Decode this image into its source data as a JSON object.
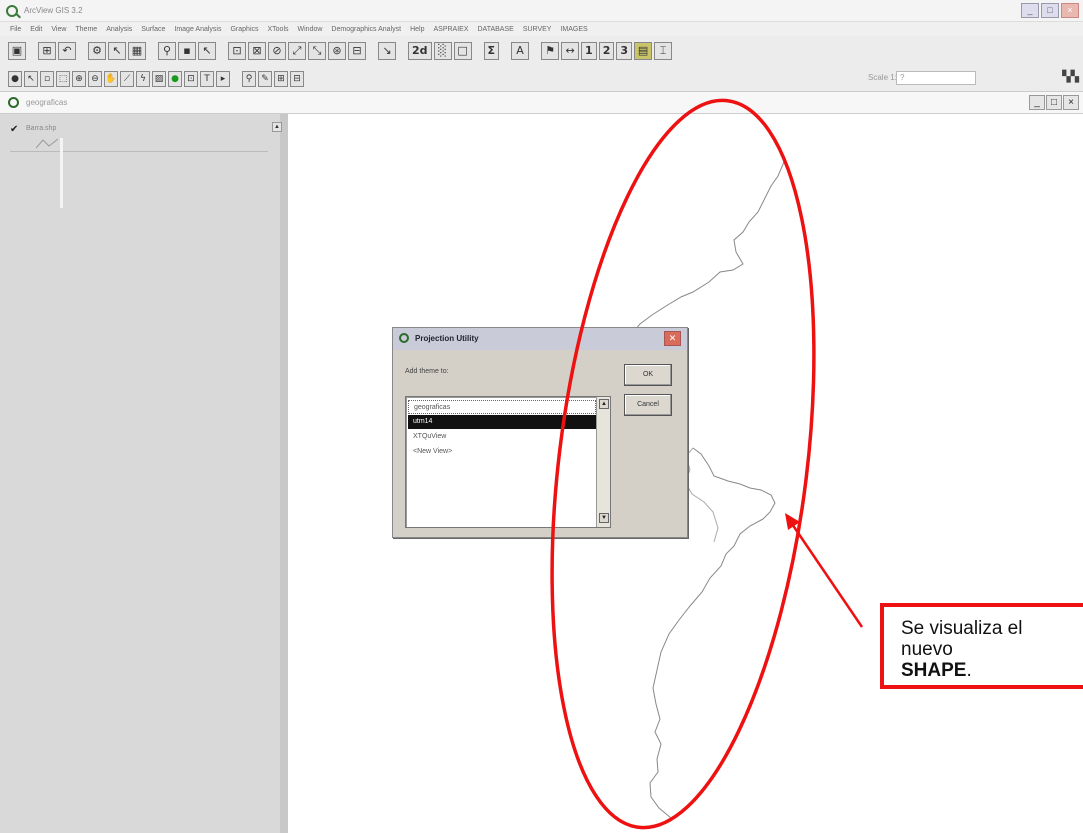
{
  "app": {
    "title": "ArcView GIS 3.2",
    "window_buttons": [
      "_",
      "□",
      "×"
    ]
  },
  "menu": [
    "File",
    "Edit",
    "View",
    "Theme",
    "Analysis",
    "Surface",
    "Image Analysis",
    "Graphics",
    "XTools",
    "Window",
    "Demographics Analyst",
    "Help",
    "ASPRAIEX",
    "DATABASE",
    "SURVEY",
    "IMAGES"
  ],
  "toolbar": {
    "text_buttons": [
      "2d",
      "Σ",
      "1",
      "2",
      "3"
    ]
  },
  "scale": {
    "label": "Scale 1:",
    "value": "?"
  },
  "view": {
    "title": "geograficas",
    "buttons": [
      "_",
      "□",
      "×"
    ]
  },
  "toc": {
    "theme_label": "Barra.shp",
    "checked": true
  },
  "dialog": {
    "title": "Projection Utility",
    "label": "Add theme to:",
    "ok_label": "OK",
    "cancel_label": "Cancel",
    "items": [
      "geograficas",
      "utm14",
      "XTQuView",
      "<New View>"
    ],
    "selected_index": 1
  },
  "annotation": {
    "callout_line1": "Se visualiza el",
    "callout_line2": "nuevo",
    "callout_bold": "SHAPE",
    "callout_end": ".",
    "color": "#ee1111"
  }
}
